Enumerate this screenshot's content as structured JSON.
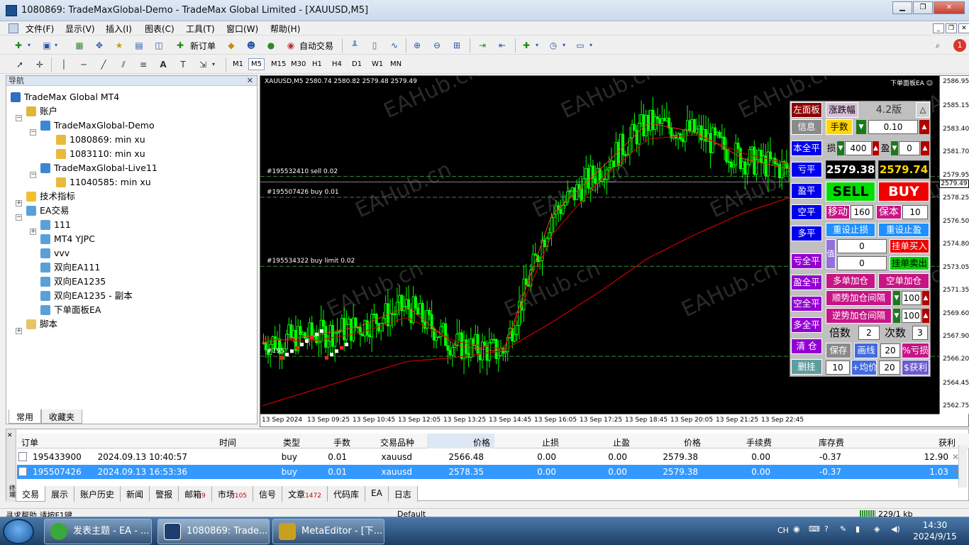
{
  "window": {
    "title": "1080869: TradeMaxGlobal-Demo - TradeMax Global Limited - [XAUUSD,M5]",
    "min": "▁",
    "max": "❐",
    "close": "✕"
  },
  "menu": [
    "文件(F)",
    "显示(V)",
    "插入(I)",
    "图表(C)",
    "工具(T)",
    "窗口(W)",
    "帮助(H)"
  ],
  "toolbar": {
    "new_order": "新订单",
    "auto_trade": "自动交易",
    "timeframes": [
      "M1",
      "M5",
      "M15",
      "M30",
      "H1",
      "H4",
      "D1",
      "W1",
      "MN"
    ],
    "active_tf": "M5",
    "notif_count": "1"
  },
  "navigator": {
    "title": "导航",
    "root": "TradeMax Global MT4",
    "accounts_label": "账户",
    "servers": [
      {
        "name": "TradeMaxGlobal-Demo",
        "accounts": [
          "1080869: min xu",
          "1083110: min xu"
        ]
      },
      {
        "name": "TradeMaxGlobal-Live11",
        "accounts": [
          "11040585: min xu"
        ]
      }
    ],
    "indicators_label": "技术指标",
    "ea_label": "EA交易",
    "eas": [
      "111",
      "MT4 YJPC",
      "vvv",
      "双向EA111",
      "双向EA1235",
      "双向EA1235 - 副本",
      "下单面板EA"
    ],
    "scripts_label": "脚本",
    "tabs": [
      "常用",
      "收藏夹"
    ]
  },
  "chart": {
    "ohlc": "XAUUSD,M5  2580.74 2580.82 2579.48 2579.49",
    "ea_tag": "下单面板EA ☺",
    "current_price": "2579.49",
    "order_lines": [
      {
        "label": "#195532410 sell 0.02",
        "price": 2579.9
      },
      {
        "label": "#195507426 buy 0.01",
        "price": 2578.35
      },
      {
        "label": "#195534322 buy limit 0.02",
        "price": 2573.2
      },
      {
        "label": "#195",
        "price": 2566.48
      }
    ],
    "price_ticks": [
      "2586.95",
      "2585.15",
      "2583.40",
      "2581.70",
      "2579.95",
      "2578.25",
      "2576.50",
      "2574.80",
      "2573.05",
      "2571.35",
      "2569.60",
      "2567.90",
      "2566.20",
      "2564.45",
      "2562.75"
    ],
    "time_ticks": [
      "13 Sep 2024",
      "13 Sep 09:25",
      "13 Sep 10:45",
      "13 Sep 12:05",
      "13 Sep 13:25",
      "13 Sep 14:45",
      "13 Sep 16:05",
      "13 Sep 17:25",
      "13 Sep 18:45",
      "13 Sep 20:05",
      "13 Sep 21:25",
      "13 Sep 22:45"
    ],
    "watermark": "EAHub.cn"
  },
  "chart_data": {
    "type": "line",
    "title": "XAUUSD,M5",
    "ylim": [
      2562.2,
      2587.4
    ],
    "x": [
      "13 Sep 2024",
      "13 Sep 09:25",
      "13 Sep 10:45",
      "13 Sep 12:05",
      "13 Sep 13:25",
      "13 Sep 14:45",
      "13 Sep 16:05",
      "13 Sep 17:25",
      "13 Sep 18:45",
      "13 Sep 20:05",
      "13 Sep 21:25",
      "13 Sep 22:45"
    ],
    "series": [
      {
        "values": [
          2567.5,
          2568.0,
          2568.7,
          2570.2,
          2567.3,
          2566.8,
          2577.0,
          2580.4,
          2583.9,
          2583.2,
          2581.2,
          2580.4
        ]
      },
      {
        "values": [
          2567.8,
          2567.6,
          2568.2,
          2569.4,
          2567.6,
          2567.0,
          2575.5,
          2579.6,
          2582.7,
          2583.0,
          2581.6,
          2580.8
        ]
      },
      {
        "values": [
          2562.8,
          2563.9,
          2565.0,
          2566.1,
          2566.4,
          2566.9,
          2569.0,
          2571.3,
          2573.8,
          2575.6,
          2577.2,
          2578.4
        ]
      }
    ]
  },
  "panel": {
    "left_panel": "左面板",
    "change": "涨跌幅",
    "version": "4.2版",
    "info": "信息",
    "lots_label": "手数",
    "lots": "0.10",
    "close_all": "本全平",
    "sl_label": "损",
    "sl": "400",
    "tp_label": "盈",
    "tp": "0",
    "loss_close": "亏平",
    "bid": "2579.38",
    "ask": "2579.74",
    "profit_close": "盈平",
    "sell": "SELL",
    "buy": "BUY",
    "short_close": "空平",
    "trail_label": "移动",
    "trail": "160",
    "be_label": "保本",
    "be": "10",
    "long_close": "多平",
    "reset_sl": "重设止损",
    "reset_tp": "重设止盈",
    "val_label": "值",
    "pend_val1": "0",
    "pend_val2": "0",
    "pend_buy": "挂单买入",
    "pend_sell": "挂单卖出",
    "loss_all": "亏全平",
    "profit_all": "盈全平",
    "short_all": "空全平",
    "long_all": "多全平",
    "clear": "清 仓",
    "del_pending": "删挂",
    "long_add": "多单加仓",
    "short_add": "空单加仓",
    "trend_add": "顺势加仓间隔",
    "trend_val": "100",
    "counter_add": "逆势加仓间隔",
    "counter_val": "100",
    "mult_label": "倍数",
    "mult": "2",
    "times_label": "次数",
    "times": "3",
    "save": "保存",
    "draw": "画线",
    "draw_val": "20",
    "pct_loss": "%亏损",
    "pending_num": "10",
    "avg_label": "+均价",
    "avg_val": "20",
    "dollar_profit": "$获利"
  },
  "terminal": {
    "headers": [
      "订单",
      "时间",
      "类型",
      "手数",
      "交易品种",
      "价格",
      "止损",
      "止盈",
      "价格",
      "手续费",
      "库存费",
      "获利"
    ],
    "rows": [
      [
        "195433900",
        "2024.09.13 10:40:57",
        "buy",
        "0.01",
        "xauusd",
        "2566.48",
        "0.00",
        "0.00",
        "2579.38",
        "0.00",
        "-0.37",
        "12.90"
      ],
      [
        "195507426",
        "2024.09.13 16:53:36",
        "buy",
        "0.01",
        "xauusd",
        "2578.35",
        "0.00",
        "0.00",
        "2579.38",
        "0.00",
        "-0.37",
        "1.03"
      ]
    ],
    "tabs": [
      {
        "label": "交易",
        "badge": ""
      },
      {
        "label": "展示",
        "badge": ""
      },
      {
        "label": "账户历史",
        "badge": ""
      },
      {
        "label": "新闻",
        "badge": ""
      },
      {
        "label": "警报",
        "badge": ""
      },
      {
        "label": "邮箱",
        "badge": "9"
      },
      {
        "label": "市场",
        "badge": "105"
      },
      {
        "label": "信号",
        "badge": ""
      },
      {
        "label": "文章",
        "badge": "1472"
      },
      {
        "label": "代码库",
        "badge": ""
      },
      {
        "label": "EA",
        "badge": ""
      },
      {
        "label": "日志",
        "badge": ""
      }
    ],
    "side_label": "终端"
  },
  "status": {
    "help": "寻求帮助,请按F1键",
    "profile": "Default",
    "traffic": "229/1 kb"
  },
  "taskbar": {
    "tasks": [
      "发表主题 - EA - ...",
      "1080869: Trade...",
      "MetaEditor - [下..."
    ],
    "lang": "CH",
    "time": "14:30",
    "date": "2024/9/15"
  }
}
